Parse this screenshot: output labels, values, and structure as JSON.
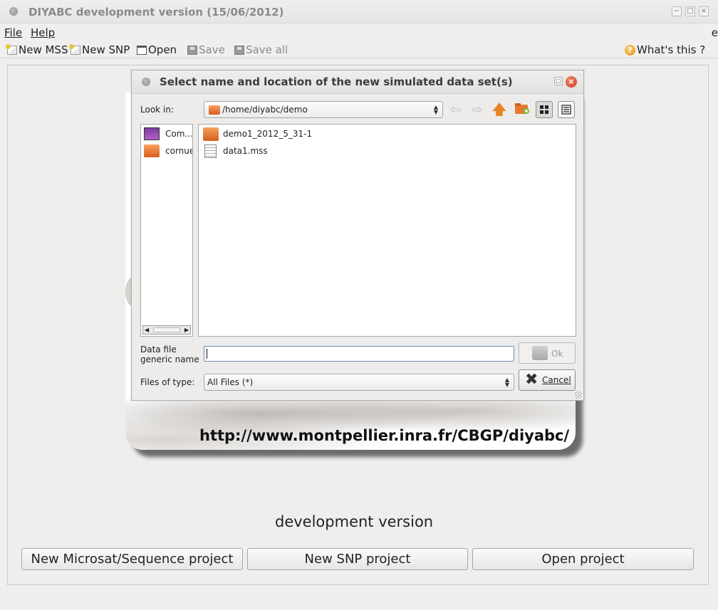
{
  "window": {
    "title": "DIYABC development version  (15/06/2012)"
  },
  "menu": {
    "file": "File",
    "help": "Help",
    "cut_text": "e"
  },
  "toolbar": {
    "new_mss": "New MSS",
    "new_snp": "New SNP",
    "open": "Open",
    "save": "Save",
    "save_all": "Save all",
    "whats_this": "What's this ?"
  },
  "splash": {
    "url": "http://www.montpellier.inra.fr/CBGP/diyabc/"
  },
  "main": {
    "version_text": "development version",
    "buttons": {
      "new_microsat": "New Microsat/Sequence project",
      "new_snp": "New SNP project",
      "open_project": "Open project"
    }
  },
  "dialog": {
    "title": "Select name and location of the new simulated data set(s)",
    "look_in_label": "Look in:",
    "look_in_value": "/home/diyabc/demo",
    "places": [
      {
        "label": "Com..."
      },
      {
        "label": "cornue"
      }
    ],
    "files": [
      {
        "name": "demo1_2012_5_31-1",
        "kind": "folder"
      },
      {
        "name": "data1.mss",
        "kind": "file"
      }
    ],
    "name_label_line1": "Data file",
    "name_label_line2": "generic name",
    "name_value": "",
    "ok_label": "Ok",
    "type_label": "Files of type:",
    "type_value": "All Files (*)",
    "cancel_label": "Cancel"
  },
  "icons": {
    "up": "arrow-up-icon",
    "back": "arrow-left-icon",
    "forward": "arrow-right-icon",
    "new_folder": "new-folder-icon",
    "list_view": "list-view-icon",
    "details_view": "details-view-icon"
  },
  "colors": {
    "accent_orange": "#e88420",
    "close_red": "#c9381b"
  }
}
